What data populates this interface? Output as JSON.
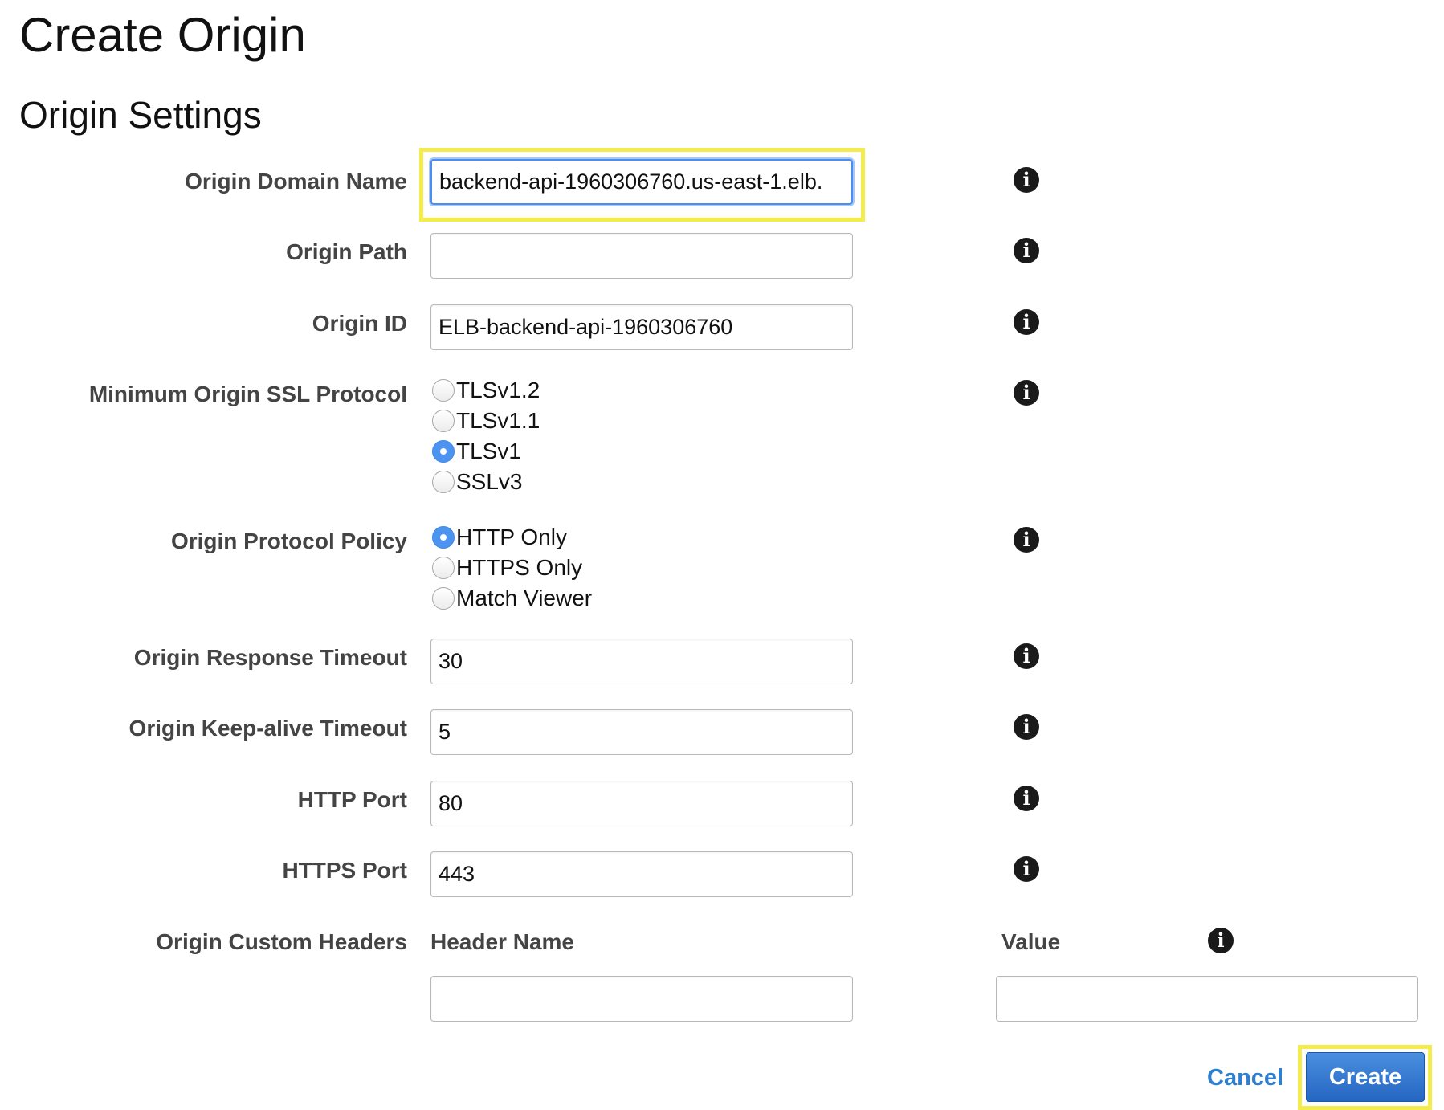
{
  "page_title": "Create Origin",
  "section_title": "Origin Settings",
  "fields": {
    "origin_domain_name": {
      "label": "Origin Domain Name",
      "value": "backend-api-1960306760.us-east-1.elb."
    },
    "origin_path": {
      "label": "Origin Path",
      "value": ""
    },
    "origin_id": {
      "label": "Origin ID",
      "value": "ELB-backend-api-1960306760"
    },
    "min_ssl_protocol": {
      "label": "Minimum Origin SSL Protocol",
      "options": [
        "TLSv1.2",
        "TLSv1.1",
        "TLSv1",
        "SSLv3"
      ],
      "selected": "TLSv1"
    },
    "protocol_policy": {
      "label": "Origin Protocol Policy",
      "options": [
        "HTTP Only",
        "HTTPS Only",
        "Match Viewer"
      ],
      "selected": "HTTP Only"
    },
    "response_timeout": {
      "label": "Origin Response Timeout",
      "value": "30"
    },
    "keepalive_timeout": {
      "label": "Origin Keep-alive Timeout",
      "value": "5"
    },
    "http_port": {
      "label": "HTTP Port",
      "value": "80"
    },
    "https_port": {
      "label": "HTTPS Port",
      "value": "443"
    },
    "custom_headers": {
      "label": "Origin Custom Headers",
      "header_name_col": "Header Name",
      "value_col": "Value",
      "header_name_value": "",
      "value_value": ""
    }
  },
  "info_icon": "info-icon",
  "buttons": {
    "cancel": "Cancel",
    "create": "Create"
  },
  "colors": {
    "highlight": "#f4ec4a",
    "link": "#2f7fd1",
    "primary": "#2566c2",
    "radio_checked": "#4d94f0"
  }
}
